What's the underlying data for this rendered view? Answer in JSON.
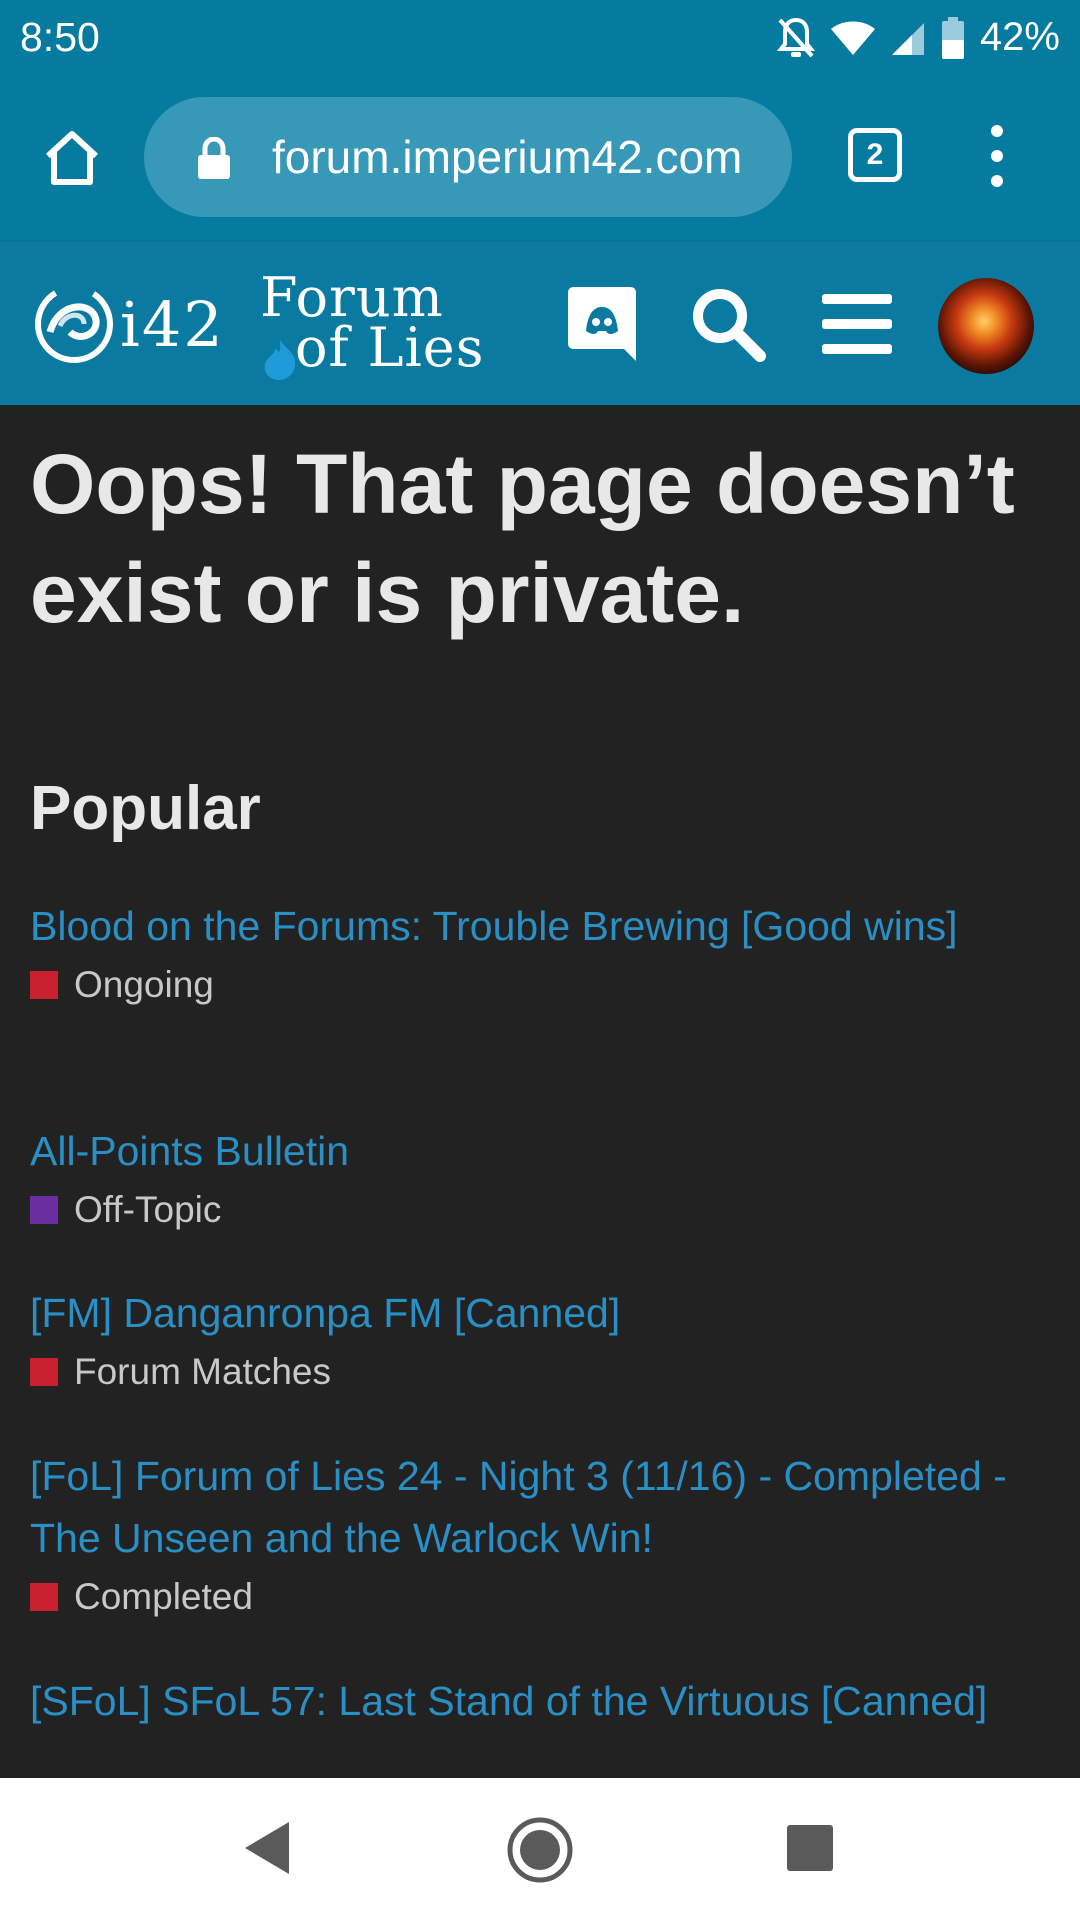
{
  "status_bar": {
    "time": "8:50",
    "battery": "42%"
  },
  "browser": {
    "url": "forum.imperium42.com",
    "tab_count": "2"
  },
  "site_header": {
    "logo_text": "i42",
    "forum_logo_line1": "Forum",
    "forum_logo_line2": "of Lies"
  },
  "main": {
    "title": "Oops! That page doesn’t exist or is private.",
    "popular_heading": "Popular",
    "topics": [
      {
        "title": "Blood on the Forums: Trouble Brewing [Good wins]",
        "category": "Ongoing",
        "category_color": "#c8202f"
      },
      {
        "title": "All-Points Bulletin",
        "category": "Off-Topic",
        "category_color": "#6a2ea0"
      },
      {
        "title": "[FM] Danganronpa FM [Canned]",
        "category": "Forum Matches",
        "category_color": "#c8202f"
      },
      {
        "title": "[FoL] Forum of Lies 24 - Night 3 (11/16) - Completed - The Unseen and the Warlock Win!",
        "category": "Completed",
        "category_color": "#c8202f"
      },
      {
        "title": "[SFoL] SFoL 57: Last Stand of the Virtuous [Canned]",
        "category": "",
        "category_color": "#c8202f"
      }
    ]
  },
  "colors": {
    "header_bg": "#067ba0",
    "page_bg": "#222222",
    "link": "#2a8fc4"
  }
}
